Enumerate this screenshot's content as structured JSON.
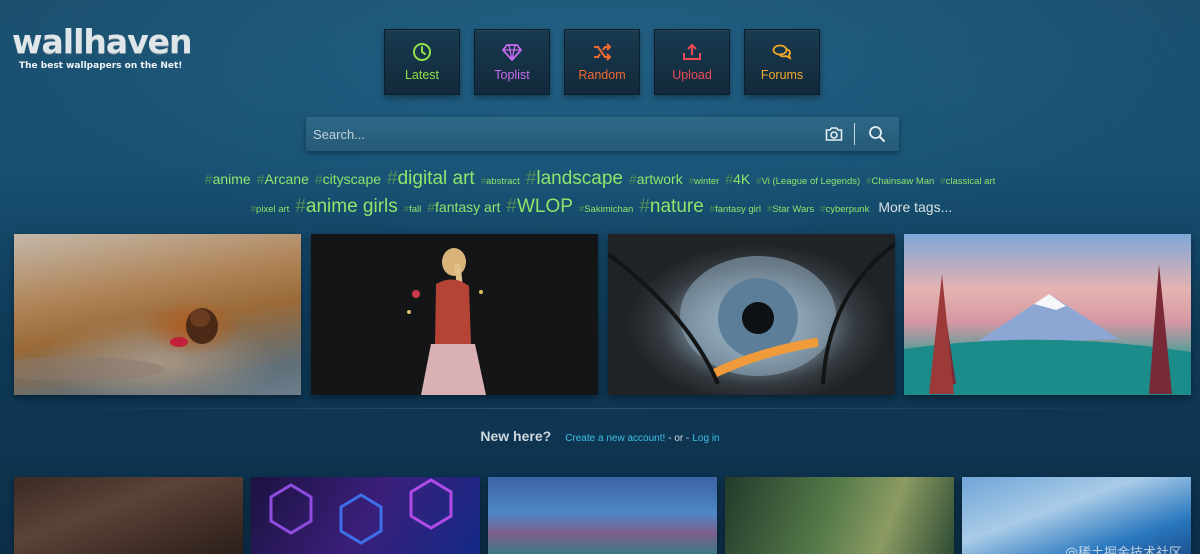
{
  "logo": {
    "word": "wallhaven",
    "tagline": "The best wallpapers on the Net!"
  },
  "nav": [
    {
      "label": "Latest",
      "icon": "clock-icon",
      "color": "#8fe04a"
    },
    {
      "label": "Toplist",
      "icon": "diamond-icon",
      "color": "#c96bf0"
    },
    {
      "label": "Random",
      "icon": "shuffle-icon",
      "color": "#f36a2e"
    },
    {
      "label": "Upload",
      "icon": "upload-icon",
      "color": "#ef4a55"
    },
    {
      "label": "Forums",
      "icon": "chat-bubbles-icon",
      "color": "#f1a92b"
    }
  ],
  "search": {
    "placeholder": "Search..."
  },
  "tags_row1": [
    {
      "text": "anime",
      "size": "s2"
    },
    {
      "text": "Arcane",
      "size": "s2"
    },
    {
      "text": "cityscape",
      "size": "s2"
    },
    {
      "text": "digital art",
      "size": "s3"
    },
    {
      "text": "abstract",
      "size": "s1"
    },
    {
      "text": "landscape",
      "size": "s3"
    },
    {
      "text": "artwork",
      "size": "s2"
    },
    {
      "text": "winter",
      "size": "s1"
    },
    {
      "text": "4K",
      "size": "s2"
    },
    {
      "text": "Vi (League of Legends)",
      "size": "s1"
    },
    {
      "text": "Chainsaw Man",
      "size": "s1"
    },
    {
      "text": "classical art",
      "size": "s1"
    }
  ],
  "tags_row2": [
    {
      "text": "pixel art",
      "size": "s1"
    },
    {
      "text": "anime girls",
      "size": "s3"
    },
    {
      "text": "fall",
      "size": "s1"
    },
    {
      "text": "fantasy art",
      "size": "s2"
    },
    {
      "text": "WLOP",
      "size": "s3"
    },
    {
      "text": "Sakimichan",
      "size": "s1"
    },
    {
      "text": "nature",
      "size": "s3"
    },
    {
      "text": "fantasy girl",
      "size": "s1"
    },
    {
      "text": "Star Wars",
      "size": "s1"
    },
    {
      "text": "cyberpunk",
      "size": "s1"
    }
  ],
  "more_tags": "More tags...",
  "tag_hash": "#",
  "new_here": {
    "lead": "New here?",
    "create": "Create a new account!",
    "or": "- or -",
    "login": "Log in"
  },
  "watermark": "@稀土掘金技术社区"
}
